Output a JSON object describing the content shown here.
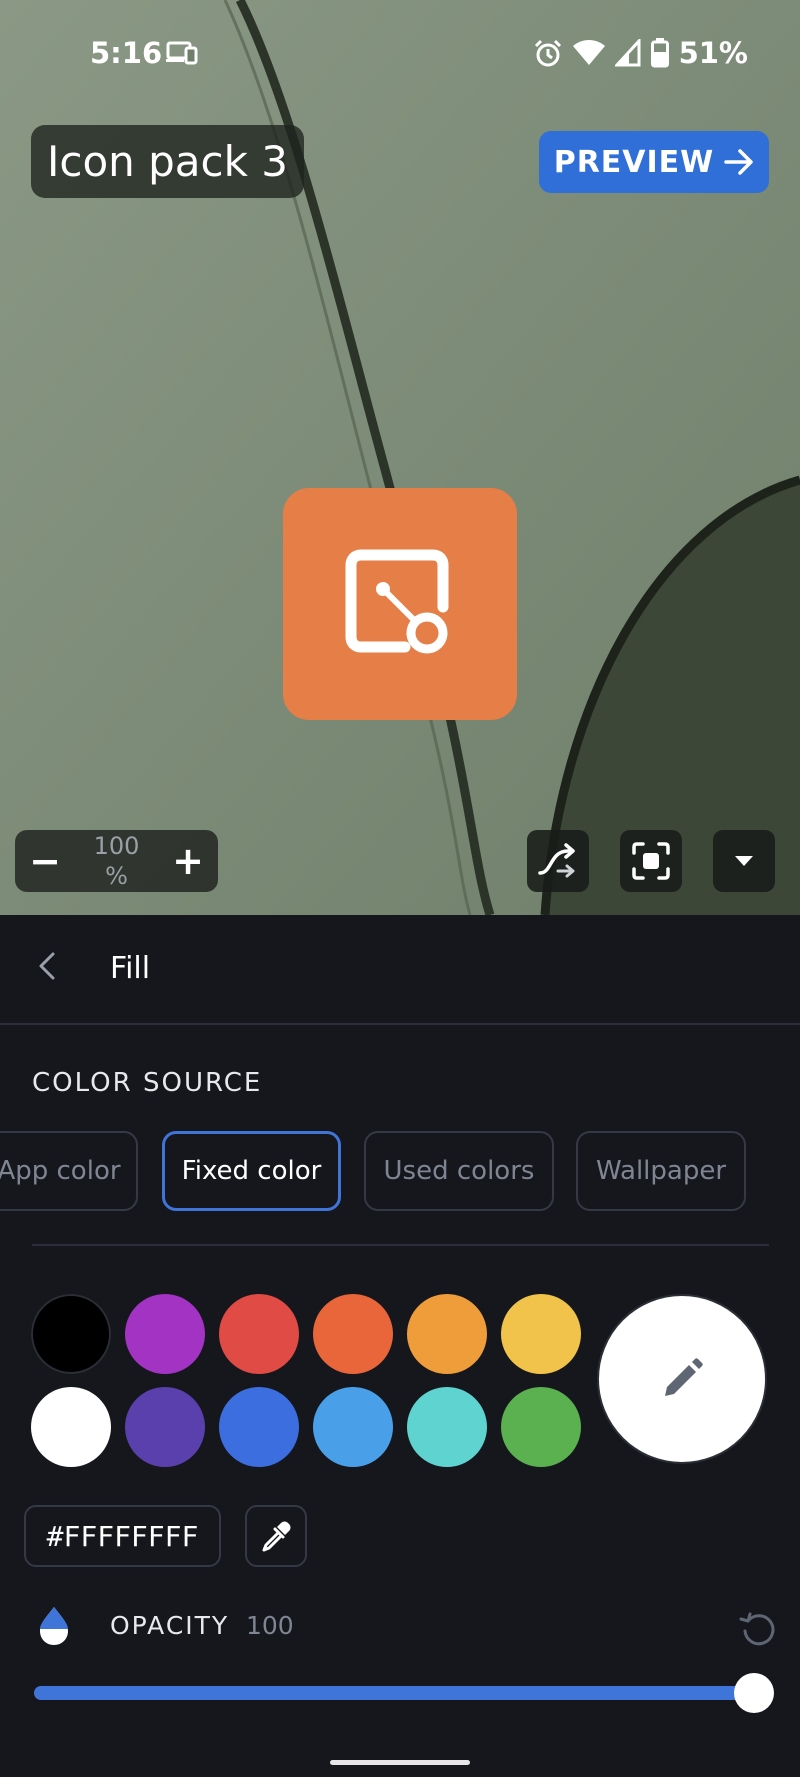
{
  "status_bar": {
    "time": "5:16",
    "battery_percent": "51%",
    "icons": [
      "cast-icon",
      "alarm-icon",
      "wifi-icon",
      "signal-icon",
      "battery-icon"
    ]
  },
  "preview": {
    "title": "Icon pack 3",
    "preview_button_label": "PREVIEW",
    "icon_background_color": "#e57f47",
    "zoom": {
      "value": "100",
      "unit": "%",
      "minus_label": "−",
      "plus_label": "+"
    },
    "tools": [
      "shuffle-icon",
      "focus-frame-icon",
      "dropdown-icon"
    ]
  },
  "panel": {
    "title": "Fill",
    "color_source_label": "COLOR SOURCE",
    "color_sources": [
      {
        "label": "App color",
        "active": false
      },
      {
        "label": "Fixed color",
        "active": true
      },
      {
        "label": "Used colors",
        "active": false
      },
      {
        "label": "Wallpaper",
        "active": false
      }
    ],
    "swatches": [
      [
        "#000000",
        "#a333c2",
        "#e04b45",
        "#e8663a",
        "#ee9d3a",
        "#f2c34a"
      ],
      [
        "#ffffff",
        "#5a40ad",
        "#3c6ee0",
        "#4aa0e8",
        "#5fd3d0",
        "#5bb04f"
      ]
    ],
    "selected_color": "#ffffff",
    "hex_value": "#FFFFFFFF",
    "opacity_label": "OPACITY",
    "opacity_value": "100",
    "opacity_fraction": 1.0,
    "accent_color": "#3f74d8"
  }
}
